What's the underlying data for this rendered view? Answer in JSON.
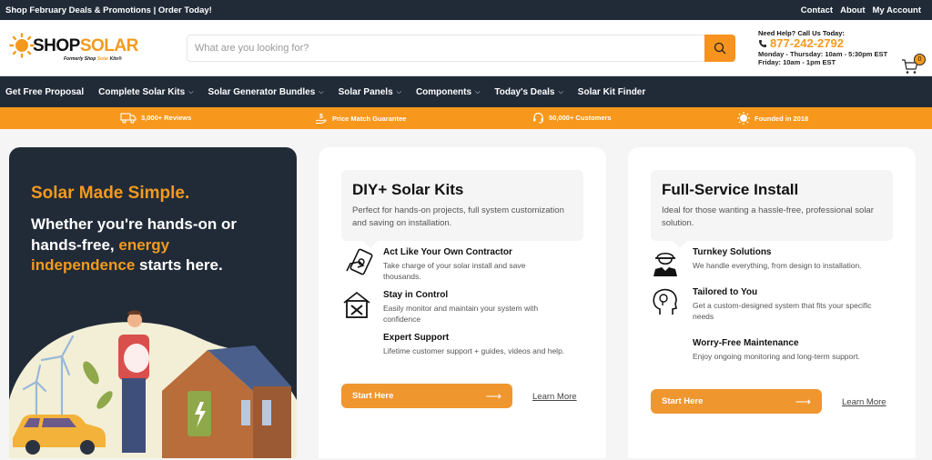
{
  "topbar": {
    "promo": "Shop February Deals & Promotions | Order Today!",
    "links": [
      "Contact",
      "About",
      "My Account"
    ]
  },
  "header": {
    "logo": {
      "shop": "SHOP",
      "solar": "SOLAR",
      "tagline_pre": "Formerly Shop ",
      "tagline_accent": "Solar",
      "tagline_post": " Kits®"
    },
    "search": {
      "placeholder": "What are you looking for?",
      "value": ""
    },
    "help": {
      "label": "Need Help? Call Us Today:",
      "phone": "877-242-2792",
      "hours_weekday": "Monday - Thursday: 10am - 5:30pm EST",
      "hours_friday": "Friday: 10am - 1pm EST"
    },
    "cart_count": "0"
  },
  "nav": {
    "items": [
      {
        "label": "Get Free Proposal",
        "dropdown": false
      },
      {
        "label": "Complete Solar Kits",
        "dropdown": true
      },
      {
        "label": "Solar Generator Bundles",
        "dropdown": true
      },
      {
        "label": "Solar Panels",
        "dropdown": true
      },
      {
        "label": "Components",
        "dropdown": true
      },
      {
        "label": "Today's Deals",
        "dropdown": true
      },
      {
        "label": "Solar Kit Finder",
        "dropdown": false
      }
    ]
  },
  "promo_bar": [
    {
      "icon": "truck-icon",
      "label": "3,000+ Reviews"
    },
    {
      "icon": "hand-dollar-icon",
      "label": "Price Match Guarantee"
    },
    {
      "icon": "headset-icon",
      "label": "50,000+ Customers"
    },
    {
      "icon": "sun-icon",
      "label": "Founded in 2018"
    }
  ],
  "hero": {
    "title": "Solar Made Simple.",
    "line_pre": "Whether you're hands-on or hands-free, ",
    "line_accent": "energy independence",
    "line_post": " starts here."
  },
  "cards": [
    {
      "title": "DIY+ Solar Kits",
      "description": "Perfect for hands-on projects, full system customization and saving on installation.",
      "features": [
        {
          "icon": "hand-money-icon",
          "title": "Act Like Your Own Contractor",
          "text": "Take charge of your solar install and save thousands."
        },
        {
          "icon": "house-tools-icon",
          "title": "Stay in Control",
          "text": "Easily monitor and maintain your system with confidence"
        },
        {
          "icon": "",
          "title": "Expert Support",
          "text": "Lifetime customer support + guides, videos and help."
        }
      ],
      "cta": "Start Here",
      "link": "Learn More"
    },
    {
      "title": "Full-Service Install",
      "description": "Ideal for those wanting a hassle-free, professional solar solution.",
      "features": [
        {
          "icon": "worker-icon",
          "title": "Turnkey Solutions",
          "text": "We handle everything, from design to installation."
        },
        {
          "icon": "idea-head-icon",
          "title": "Tailored to You",
          "text": "Get a custom-designed system that fits your specific needs"
        },
        {
          "icon": "",
          "title": "Worry-Free Maintenance",
          "text": "Enjoy ongoing monitoring and long-term support."
        }
      ],
      "cta": "Start Here",
      "link": "Learn More"
    }
  ],
  "colors": {
    "dark": "#212b38",
    "accent": "#f7981d",
    "button": "#f0962f"
  }
}
